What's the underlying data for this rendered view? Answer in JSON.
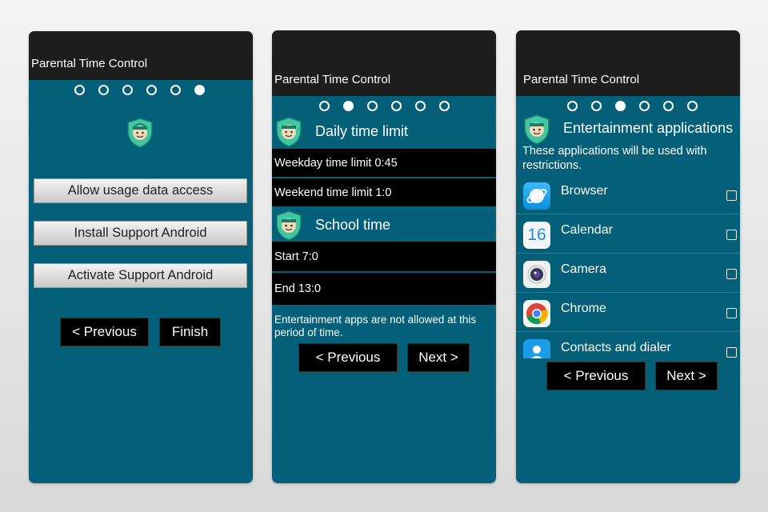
{
  "app_title": "Parental Time Control",
  "screen1": {
    "buttons": [
      "Allow usage data access",
      "Install Support Android",
      "Activate Support Android"
    ],
    "previous": "< Previous",
    "finish": "Finish"
  },
  "screen2": {
    "daily_title": "Daily time limit",
    "weekday": "Weekday time limit 0:45",
    "weekend": "Weekend time limit 1:0",
    "school_title": "School time",
    "start": "Start 7:0",
    "end": "End 13:0",
    "note": "Entertainment apps are not allowed at this period of time.",
    "previous": "< Previous",
    "next": "Next >"
  },
  "screen3": {
    "title": "Entertainment applications",
    "description": "These applications will be used with restrictions.",
    "apps": [
      {
        "label": "Browser",
        "icon": "browser-icon"
      },
      {
        "label": "Calendar",
        "icon": "calendar-icon"
      },
      {
        "label": "Camera",
        "icon": "camera-icon"
      },
      {
        "label": "Chrome",
        "icon": "chrome-icon"
      },
      {
        "label": "Contacts and dialer",
        "icon": "contacts-icon"
      }
    ],
    "calendar_icon_text": "16",
    "previous": "< Previous",
    "next": "Next >"
  },
  "colors": {
    "teal_background": "#045f78",
    "app_bar": "#1d1d1d",
    "button_black": "#000000"
  }
}
